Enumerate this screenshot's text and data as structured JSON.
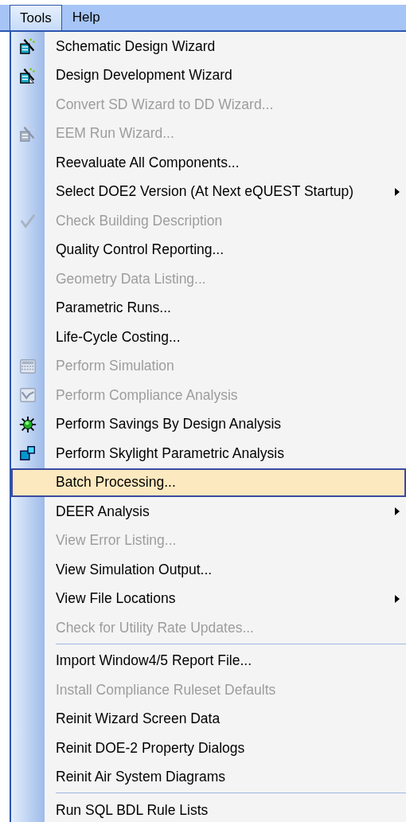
{
  "menubar": [
    {
      "label": "Tools",
      "selected": true
    },
    {
      "label": "Help",
      "selected": false
    }
  ],
  "menu": {
    "items": [
      {
        "kind": "wizard",
        "label": "Schematic Design Wizard",
        "disabled": false,
        "submenu": false,
        "selected": false
      },
      {
        "kind": "wizard-doc",
        "label": "Design Development Wizard",
        "disabled": false,
        "submenu": false,
        "selected": false
      },
      {
        "kind": "text",
        "label": "Convert SD Wizard to DD Wizard...",
        "disabled": true,
        "submenu": false,
        "selected": false
      },
      {
        "kind": "wizard",
        "label": "EEM Run Wizard...",
        "disabled": true,
        "submenu": false,
        "selected": false
      },
      {
        "kind": "text",
        "label": "Reevaluate All Components...",
        "disabled": false,
        "submenu": false,
        "selected": false
      },
      {
        "kind": "text",
        "label": "Select DOE2 Version (At Next eQUEST Startup)",
        "disabled": false,
        "submenu": true,
        "selected": false
      },
      {
        "kind": "check",
        "label": "Check Building Description",
        "disabled": true,
        "submenu": false,
        "selected": false
      },
      {
        "kind": "text",
        "label": "Quality Control Reporting...",
        "disabled": false,
        "submenu": false,
        "selected": false
      },
      {
        "kind": "text",
        "label": "Geometry Data Listing...",
        "disabled": true,
        "submenu": false,
        "selected": false
      },
      {
        "kind": "text",
        "label": "Parametric Runs...",
        "disabled": false,
        "submenu": false,
        "selected": false
      },
      {
        "kind": "text",
        "label": "Life-Cycle Costing...",
        "disabled": false,
        "submenu": false,
        "selected": false
      },
      {
        "kind": "keypad",
        "label": "Perform Simulation",
        "disabled": true,
        "submenu": false,
        "selected": false
      },
      {
        "kind": "chart",
        "label": "Perform Compliance Analysis",
        "disabled": true,
        "submenu": false,
        "selected": false
      },
      {
        "kind": "sun",
        "label": "Perform Savings By Design Analysis",
        "disabled": false,
        "submenu": false,
        "selected": false
      },
      {
        "kind": "squares",
        "label": "Perform Skylight Parametric Analysis",
        "disabled": false,
        "submenu": false,
        "selected": false
      },
      {
        "kind": "text",
        "label": "Batch Processing...",
        "disabled": false,
        "submenu": false,
        "selected": true
      },
      {
        "kind": "text",
        "label": "DEER Analysis",
        "disabled": false,
        "submenu": true,
        "selected": false
      },
      {
        "kind": "text",
        "label": "View Error Listing...",
        "disabled": true,
        "submenu": false,
        "selected": false
      },
      {
        "kind": "text",
        "label": "View Simulation Output...",
        "disabled": false,
        "submenu": false,
        "selected": false
      },
      {
        "kind": "text",
        "label": "View File Locations",
        "disabled": false,
        "submenu": true,
        "selected": false
      },
      {
        "kind": "text",
        "label": "Check for Utility Rate Updates...",
        "disabled": true,
        "submenu": false,
        "selected": false
      },
      {
        "kind": "separator"
      },
      {
        "kind": "text",
        "label": "Import Window4/5 Report File...",
        "disabled": false,
        "submenu": false,
        "selected": false
      },
      {
        "kind": "text",
        "label": "Install Compliance Ruleset Defaults",
        "disabled": true,
        "submenu": false,
        "selected": false
      },
      {
        "kind": "text",
        "label": "Reinit Wizard Screen Data",
        "disabled": false,
        "submenu": false,
        "selected": false
      },
      {
        "kind": "text",
        "label": "Reinit DOE-2 Property Dialogs",
        "disabled": false,
        "submenu": false,
        "selected": false
      },
      {
        "kind": "text",
        "label": "Reinit Air System Diagrams",
        "disabled": false,
        "submenu": false,
        "selected": false
      },
      {
        "kind": "separator"
      },
      {
        "kind": "text",
        "label": "Run SQL BDL Rule Lists",
        "disabled": false,
        "submenu": false,
        "selected": false
      }
    ]
  }
}
